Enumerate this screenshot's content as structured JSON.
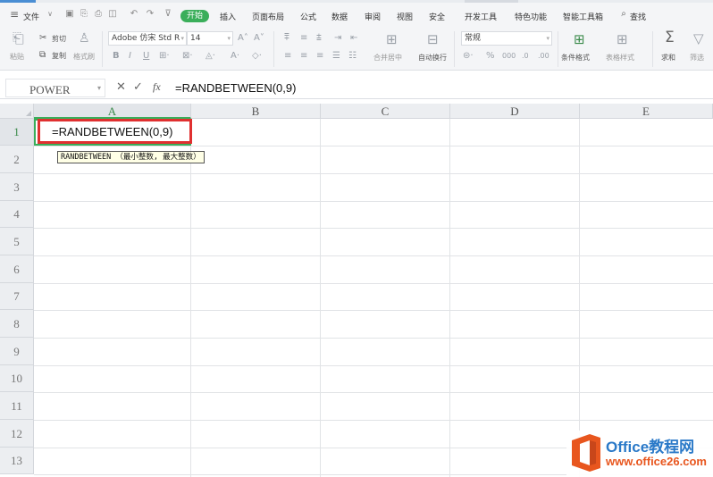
{
  "menu": {
    "file": "文件",
    "tabs": [
      "开始",
      "插入",
      "页面布局",
      "公式",
      "数据",
      "审阅",
      "视图",
      "安全",
      "开发工具",
      "特色功能",
      "智能工具箱"
    ],
    "search": "查找"
  },
  "ribbon": {
    "paste": "粘贴",
    "cut": "剪切",
    "copy": "复制",
    "format_painter": "格式刷",
    "font_name": "Adobe 仿宋 Std R",
    "font_size": "14",
    "merge_center": "合并居中",
    "wrap_text": "自动换行",
    "number_format": "常规",
    "cond_format": "条件格式",
    "table_style": "表格样式",
    "sum": "求和",
    "filter": "筛选"
  },
  "formula_bar": {
    "name_box": "POWER",
    "fx": "fx",
    "formula": "=RANDBETWEEN(0,9)"
  },
  "grid": {
    "columns": [
      "A",
      "B",
      "C",
      "D",
      "E"
    ],
    "rows": [
      "1",
      "2",
      "3",
      "4",
      "5",
      "6",
      "7",
      "8",
      "9",
      "10",
      "11",
      "12",
      "13"
    ],
    "active_column": "A",
    "active_row": "1",
    "cell_a1": "=RANDBETWEEN(0,9)",
    "tooltip": "RANDBETWEEN （最小整数, 最大整数）"
  },
  "watermark": {
    "line1": "Office教程网",
    "line2": "www.office26.com"
  },
  "colors": {
    "accent_green": "#3aae5a",
    "highlight_red": "#e03030",
    "watermark_blue": "#2a79c8",
    "watermark_orange": "#e8561e"
  }
}
